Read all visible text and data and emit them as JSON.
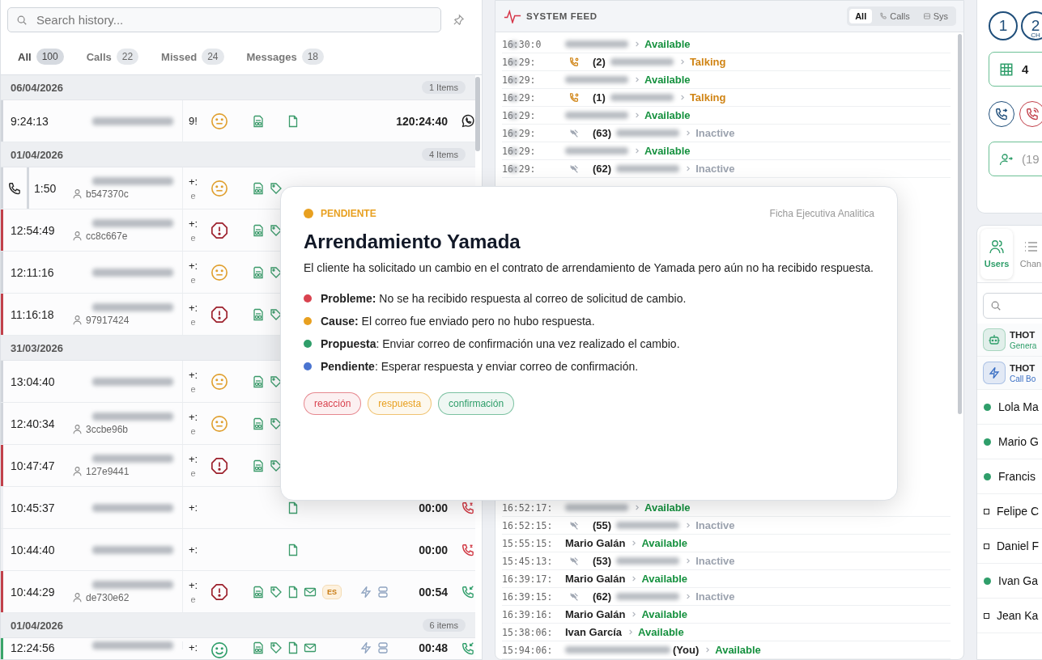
{
  "history": {
    "search": {
      "placeholder": "Search history..."
    },
    "tabs": [
      {
        "label": "All",
        "count": "100",
        "selected": true
      },
      {
        "label": "Calls",
        "count": "22",
        "selected": false
      },
      {
        "label": "Missed",
        "count": "24",
        "selected": false
      },
      {
        "label": "Messages",
        "count": "18",
        "selected": false
      }
    ],
    "groups": [
      {
        "date": "06/04/2026",
        "count": "1 Items",
        "rows": [
          {
            "time": "9:24:13",
            "call_icon": false,
            "color": "#d1d5db",
            "column_3": "9!",
            "mood": {
              "kind": "neutral"
            },
            "icons": [
              {
                "kind": "report"
              },
              {
                "kind": "file"
              }
            ],
            "duration": "120:24:40",
            "call_type": {
              "kind": "whatsapp"
            }
          }
        ]
      },
      {
        "date": "01/04/2026",
        "count": "4 Items",
        "rows": [
          {
            "time": "1:50",
            "call_icon": true,
            "color": "#d1d5db",
            "agent": "b547370c",
            "column_3": "+:",
            "column_3_sub": "e",
            "mood": {
              "kind": "neutral"
            },
            "icons": [
              {
                "kind": "report"
              },
              {
                "kind": "tag"
              }
            ]
          },
          {
            "time": "12:54:49",
            "call_icon": false,
            "color": "#c2414b",
            "agent": "cc8c667e",
            "column_3": "+:",
            "column_3_sub": "e",
            "mood": {
              "kind": "alert"
            },
            "icons": [
              {
                "kind": "report"
              },
              {
                "kind": "tag"
              }
            ]
          },
          {
            "time": "12:11:16",
            "call_icon": false,
            "color": "#d1d5db",
            "column_3": "+:",
            "column_3_sub": "e",
            "mood": {
              "kind": "neutral"
            },
            "icons": [
              {
                "kind": "report"
              },
              {
                "kind": "tag"
              }
            ]
          },
          {
            "time": "11:16:18",
            "call_icon": false,
            "color": "#c2414b",
            "agent": "97917424",
            "column_3": "+:",
            "column_3_sub": "e",
            "mood": {
              "kind": "alert"
            },
            "icons": [
              {
                "kind": "report"
              },
              {
                "kind": "tag"
              }
            ]
          }
        ]
      },
      {
        "date": "31/03/2026",
        "rows": [
          {
            "time": "13:04:40",
            "call_icon": false,
            "color": "#d1d5db",
            "column_3": "+:",
            "column_3_sub": "e",
            "mood": {
              "kind": "neutral"
            },
            "icons": [
              {
                "kind": "report"
              },
              {
                "kind": "tag"
              }
            ]
          },
          {
            "time": "12:40:34",
            "call_icon": false,
            "color": "#d1d5db",
            "agent": "3ccbe96b",
            "column_3": "+:",
            "column_3_sub": "e",
            "mood": {
              "kind": "neutral"
            },
            "icons": [
              {
                "kind": "report"
              },
              {
                "kind": "tag"
              }
            ]
          },
          {
            "time": "10:47:47",
            "call_icon": false,
            "color": "#c2414b",
            "agent": "127e9441",
            "column_3": "+:",
            "column_3_sub": "e",
            "mood": {
              "kind": "alert"
            },
            "icons": [
              {
                "kind": "report"
              },
              {
                "kind": "tag"
              }
            ]
          },
          {
            "time": "10:45:37",
            "call_icon": false,
            "color": "#eef0f3",
            "column_3": "+:",
            "icons": [
              {
                "kind": "file"
              }
            ],
            "duration": "00:00",
            "call_type": {
              "kind": "missed"
            }
          },
          {
            "time": "10:44:40",
            "call_icon": false,
            "color": "#eef0f3",
            "column_3": "+:",
            "icons": [
              {
                "kind": "file"
              }
            ],
            "duration": "00:00",
            "call_type": {
              "kind": "missed"
            }
          },
          {
            "time": "10:44:29",
            "call_icon": false,
            "color": "#c2414b",
            "agent": "de730e62",
            "column_3": "+:",
            "column_3_sub": "e",
            "mood": {
              "kind": "alert"
            },
            "icons": [
              {
                "kind": "report"
              },
              {
                "kind": "tag"
              },
              {
                "kind": "file"
              },
              {
                "kind": "mail"
              },
              {
                "kind": "lang",
                "label": "ES"
              },
              {
                "kind": "bolt"
              },
              {
                "kind": "db"
              }
            ],
            "duration": "00:54",
            "call_type": {
              "kind": "incoming"
            }
          }
        ]
      },
      {
        "date": "01/04/2026",
        "count": "6 items",
        "rows": [
          {
            "time": "12:24:56",
            "call_icon": false,
            "color": "#3aa56a",
            "column_3": "+:",
            "mood": {
              "kind": "happy"
            },
            "icons": [
              {
                "kind": "report"
              },
              {
                "kind": "tag"
              },
              {
                "kind": "file"
              },
              {
                "kind": "mail"
              },
              {
                "kind": "bolt"
              },
              {
                "kind": "db"
              }
            ],
            "duration": "00:48",
            "call_type": {
              "kind": "incoming"
            }
          }
        ]
      }
    ]
  },
  "feed": {
    "title": "SYSTEM FEED",
    "filters": [
      {
        "label": "All",
        "kind": "all",
        "selected": true
      },
      {
        "label": "Calls",
        "kind": "calls",
        "selected": false
      },
      {
        "label": "Sys",
        "kind": "sys",
        "selected": false
      }
    ],
    "rows_top": [
      {
        "kind": "plain",
        "time": "16:30:0",
        "time_redacted": true,
        "status": {
          "kind": "available",
          "label": "Available"
        }
      },
      {
        "kind": "call",
        "time": "16:29:",
        "time_redacted": true,
        "count": "(2)",
        "status": {
          "kind": "talking",
          "label": "Talking"
        }
      },
      {
        "kind": "plain",
        "time": "16:29:",
        "time_redacted": true,
        "status": {
          "kind": "available",
          "label": "Available"
        }
      },
      {
        "kind": "call",
        "time": "16:29:",
        "time_redacted": true,
        "count": "(1)",
        "status": {
          "kind": "talking",
          "label": "Talking"
        }
      },
      {
        "kind": "plain",
        "time": "16:29:",
        "time_redacted": true,
        "status": {
          "kind": "available",
          "label": "Available"
        }
      },
      {
        "kind": "offline",
        "time": "16:29:",
        "time_redacted": true,
        "count": "(63)",
        "status": {
          "kind": "inactive",
          "label": "Inactive"
        }
      },
      {
        "kind": "plain",
        "time": "16:29:",
        "time_redacted": true,
        "status": {
          "kind": "available",
          "label": "Available"
        }
      },
      {
        "kind": "offline",
        "time": "16:29:",
        "time_redacted": true,
        "count": "(62)",
        "status": {
          "kind": "inactive",
          "label": "Inactive"
        }
      }
    ],
    "rows_bottom": [
      {
        "kind": "plain",
        "time": "16:52:17:",
        "time_redacted": false,
        "status": {
          "kind": "available",
          "label": "Available"
        }
      },
      {
        "kind": "offline",
        "time": "16:52:15:",
        "time_redacted": false,
        "count": "(55)",
        "status": {
          "kind": "inactive",
          "label": "Inactive"
        }
      },
      {
        "kind": "plain",
        "time": "15:55:15:",
        "time_redacted": false,
        "name": "Mario Galán",
        "status": {
          "kind": "available",
          "label": "Available"
        }
      },
      {
        "kind": "offline",
        "time": "15:45:13:",
        "time_redacted": false,
        "count": "(53)",
        "status": {
          "kind": "inactive",
          "label": "Inactive"
        }
      },
      {
        "kind": "plain",
        "time": "16:39:17:",
        "time_redacted": false,
        "name": "Mario Galán",
        "status": {
          "kind": "available",
          "label": "Available"
        }
      },
      {
        "kind": "offline",
        "time": "16:39:15:",
        "time_redacted": false,
        "count": "(62)",
        "status": {
          "kind": "inactive",
          "label": "Inactive"
        }
      },
      {
        "kind": "plain",
        "time": "16:39:16:",
        "time_redacted": false,
        "name": "Mario Galán",
        "status": {
          "kind": "available",
          "label": "Available"
        }
      },
      {
        "kind": "plain",
        "time": "15:38:06:",
        "time_redacted": false,
        "name": "Ivan García",
        "status": {
          "kind": "available",
          "label": "Available"
        }
      },
      {
        "kind": "plain",
        "time": "15:94:06:",
        "time_redacted": false,
        "suffix": "(You)",
        "status": {
          "kind": "available",
          "label": "Available"
        }
      }
    ]
  },
  "agent_panel": {
    "counters": [
      {
        "value": "1"
      },
      {
        "value": "2",
        "sub": "CH"
      }
    ],
    "queue": {
      "value": "4"
    },
    "actions": [
      {
        "kind": "transfer"
      },
      {
        "kind": "ringing"
      }
    ],
    "contact": {
      "text": "(19"
    },
    "tabs": [
      {
        "label": "Users",
        "kind": "users",
        "selected": true
      },
      {
        "label": "Chan",
        "kind": "list",
        "selected": false
      }
    ],
    "bots": [
      {
        "title": "THOT",
        "subtitle": "Genera",
        "kind": "robot",
        "color": "#2f9e6a"
      },
      {
        "title": "THOT",
        "subtitle": "Call Bo",
        "kind": "bolt",
        "color": "#3a6fc4"
      }
    ],
    "users": [
      {
        "name": "Lola Ma",
        "online": true
      },
      {
        "name": "Mario G",
        "online": true
      },
      {
        "name": "Francis",
        "online": true
      },
      {
        "name": "Felipe C",
        "online": false
      },
      {
        "name": "Daniel F",
        "online": false
      },
      {
        "name": "Ivan Ga",
        "online": true
      },
      {
        "name": "Jean Ka",
        "online": false
      }
    ]
  },
  "popup": {
    "status": {
      "label": "PENDIENTE",
      "color": "#e8a020"
    },
    "source": "Ficha Ejecutiva Analitica",
    "title": "Arrendamiento Yamada",
    "description": "El cliente ha solicitado un cambio en el contrato de arrendamiento de Yamada pero aún no ha recibido respuesta.",
    "points": [
      {
        "text": "**Probleme:** No se ha recibido respuesta al correo de solicitud de cambio.",
        "color": "#d9434f"
      },
      {
        "text": "**Cause:** El correo fue enviado pero no hubo respuesta.",
        "color": "#e8a020"
      },
      {
        "text": "**Propuesta**: Enviar correo de confirmación una vez realizado el cambio.",
        "color": "#2f9e6a"
      },
      {
        "text": "**Pendiente**: Esperar respuesta y enviar correo de confirmación.",
        "color": "#4a74d0"
      }
    ],
    "tags": [
      {
        "label": "reacción",
        "color": "#d9434f"
      },
      {
        "label": "respuesta",
        "color": "#e8a020"
      },
      {
        "label": "confirmación",
        "color": "#2f9e6a"
      }
    ]
  }
}
